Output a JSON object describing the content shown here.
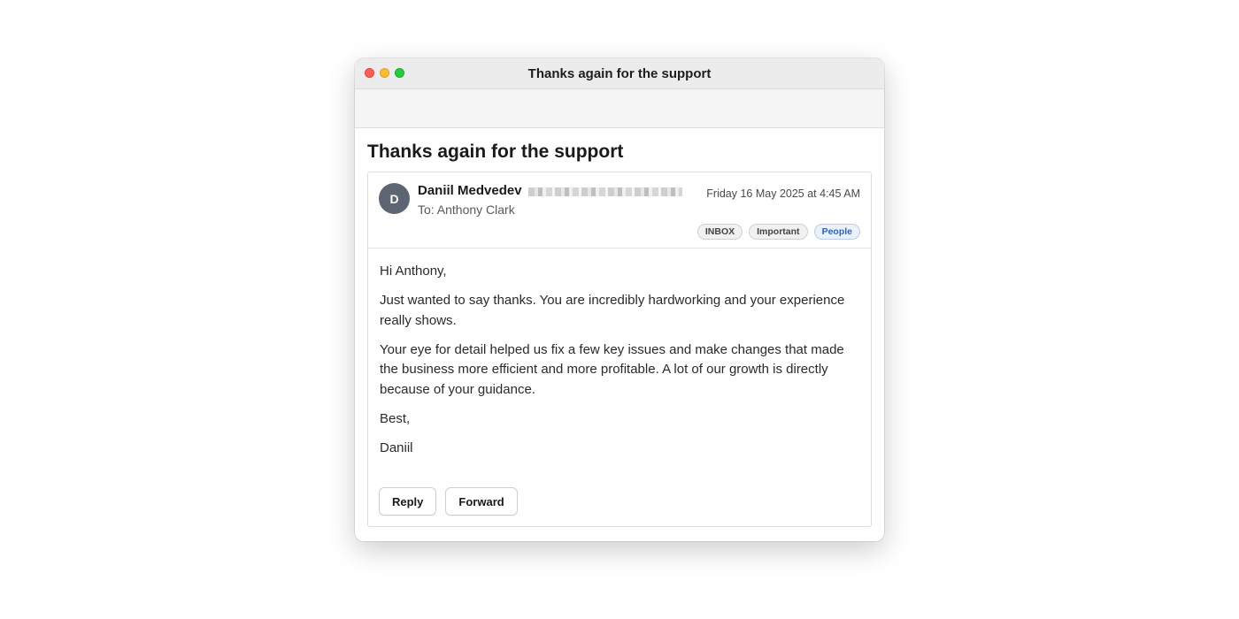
{
  "window": {
    "title": "Thanks again for the support"
  },
  "email": {
    "subject": "Thanks again for the support",
    "sender": {
      "initial": "D",
      "name": "Daniil Medvedev"
    },
    "to": "To: Anthony Clark",
    "date": "Friday 16 May 2025 at 4:45 AM",
    "tags": [
      "INBOX",
      "Important",
      "People"
    ],
    "body": [
      "Hi Anthony,",
      "Just wanted to say thanks. You are incredibly hardworking and your experience really shows.",
      "Your eye for detail helped us fix a few key issues and make changes that made the business more efficient and more profitable. A lot of our growth is directly because of your guidance.",
      "Best,",
      "Daniil"
    ]
  },
  "actions": {
    "reply_label": "Reply",
    "forward_label": "Forward"
  },
  "colors": {
    "avatar": "#5d6573",
    "people_tag": "#2d63b8",
    "close": "#ff5f57",
    "minimize": "#febc2e",
    "maximize": "#28c840"
  }
}
